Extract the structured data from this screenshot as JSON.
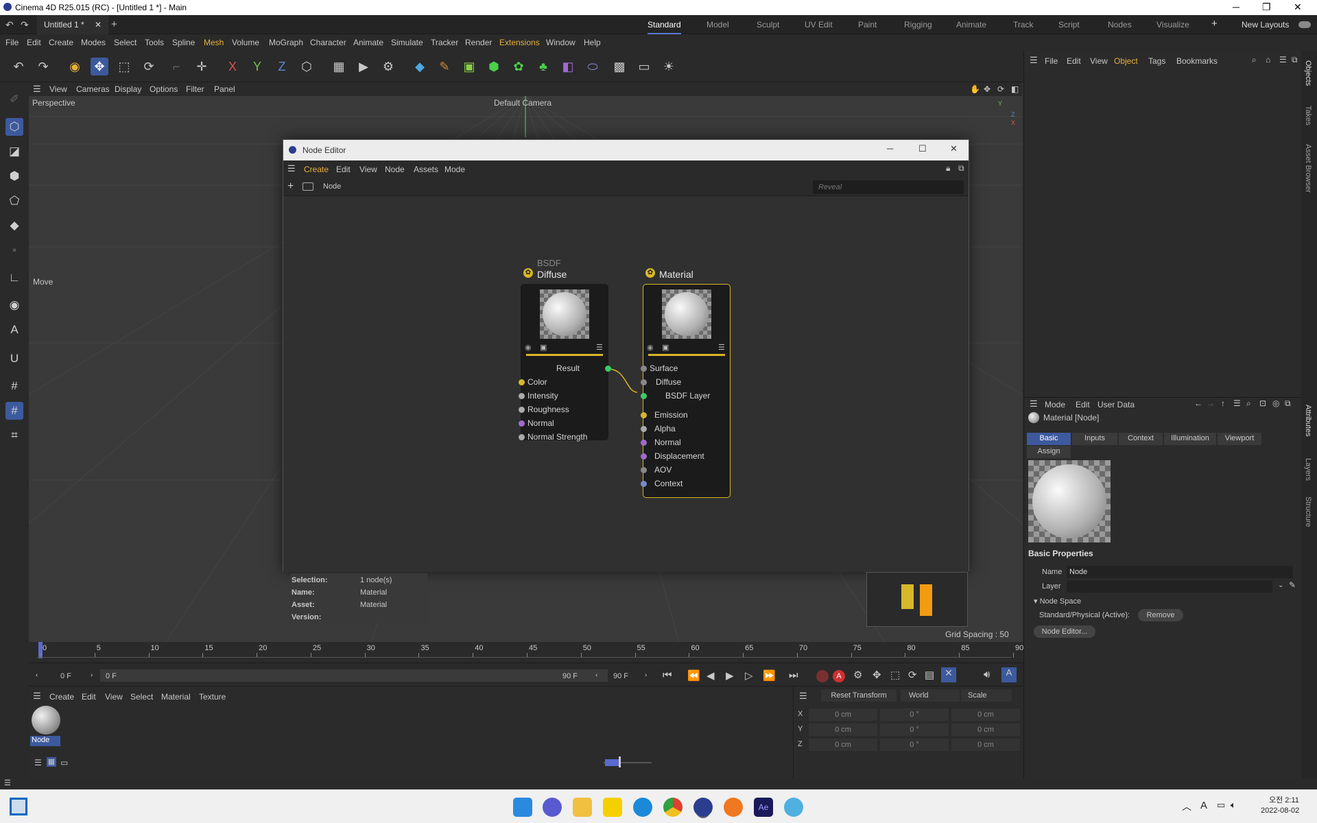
{
  "window": {
    "title": "Cinema 4D R25.015 (RC) - [Untitled 1 *] - Main"
  },
  "tabs": {
    "doc": "Untitled 1 *",
    "close": "✕",
    "add": "+"
  },
  "layouts": [
    "Standard",
    "Model",
    "Sculpt",
    "UV Edit",
    "Paint",
    "Rigging",
    "Animate",
    "Track",
    "Script",
    "Nodes",
    "Visualize"
  ],
  "layouts_extra": {
    "new": "New Layouts",
    "plus": "+"
  },
  "menu": [
    "File",
    "Edit",
    "Create",
    "Modes",
    "Select",
    "Tools",
    "Spline",
    "Mesh",
    "Volume",
    "MoGraph",
    "Character",
    "Animate",
    "Simulate",
    "Tracker",
    "Render",
    "Extensions",
    "Window",
    "Help"
  ],
  "viewport": {
    "menu": [
      "View",
      "Cameras",
      "Display",
      "Options",
      "Filter",
      "Panel"
    ],
    "label": "Perspective",
    "camera": "Default Camera",
    "move": "Move",
    "grid": "Grid Spacing : 50 cm",
    "axes": {
      "x": "X",
      "y": "Y",
      "z": "Z"
    }
  },
  "object_manager": {
    "menu": [
      "File",
      "Edit",
      "View",
      "Object",
      "Tags",
      "Bookmarks"
    ]
  },
  "side_tabs": [
    "Objects",
    "Takes",
    "Asset Browser",
    "Attributes",
    "Layers",
    "Structure"
  ],
  "node_editor": {
    "title": "Node Editor",
    "menu": [
      "Create",
      "Edit",
      "View",
      "Node",
      "Assets",
      "Mode"
    ],
    "crumb": "Node",
    "search_placeholder": "Reveal",
    "diffuse": {
      "group": "BSDF",
      "title": "Diffuse",
      "output": "Result",
      "inputs": [
        "Color",
        "Intensity",
        "Roughness",
        "Normal",
        "Normal Strength"
      ]
    },
    "material": {
      "title": "Material",
      "surface": "Surface",
      "diffuse": "Diffuse",
      "layer": "BSDF Layer",
      "inputs": [
        "Emission",
        "Alpha",
        "Normal",
        "Displacement",
        "AOV",
        "Context"
      ]
    },
    "info": {
      "selection_label": "Selection:",
      "selection_value": "1 node(s)",
      "name_label": "Name:",
      "name_value": "Material",
      "asset_label": "Asset:",
      "asset_value": "Material",
      "version_label": "Version:"
    }
  },
  "attributes": {
    "menu": [
      "Mode",
      "Edit",
      "User Data"
    ],
    "object": "Material [Node]",
    "tabs": [
      "Basic",
      "Inputs",
      "Context",
      "Illumination",
      "Viewport"
    ],
    "assign": "Assign",
    "section": "Basic Properties",
    "name_label": "Name",
    "name_value": "Node",
    "layer_label": "Layer",
    "node_space": "Node Space",
    "space_label": "Standard/Physical (Active):",
    "remove": "Remove",
    "node_editor_btn": "Node Editor..."
  },
  "timeline": {
    "ticks": [
      "0",
      "5",
      "10",
      "15",
      "20",
      "25",
      "30",
      "35",
      "40",
      "45",
      "50",
      "55",
      "60",
      "65",
      "70",
      "75",
      "80",
      "85",
      "90"
    ],
    "start": "0 F",
    "current": "0 F",
    "end": "90 F",
    "end2": "90 F"
  },
  "material_manager": {
    "menu": [
      "Create",
      "Edit",
      "View",
      "Select",
      "Material",
      "Texture"
    ],
    "material_name": "Node"
  },
  "coords": {
    "reset": "Reset Transform",
    "world": "World",
    "scale": "Scale",
    "rows": [
      {
        "axis": "X",
        "a": "0 cm",
        "b": "0 °",
        "c": "0 cm"
      },
      {
        "axis": "Y",
        "a": "0 cm",
        "b": "0 °",
        "c": "0 cm"
      },
      {
        "axis": "Z",
        "a": "0 cm",
        "b": "0 °",
        "c": "0 cm"
      }
    ]
  },
  "taskbar": {
    "time": "오전 2:11",
    "date": "2022-08-02",
    "ime": "A"
  },
  "colors": {
    "accent": "#5a7ad0",
    "node_yellow": "#d8b728",
    "orange": "#f39c12"
  }
}
